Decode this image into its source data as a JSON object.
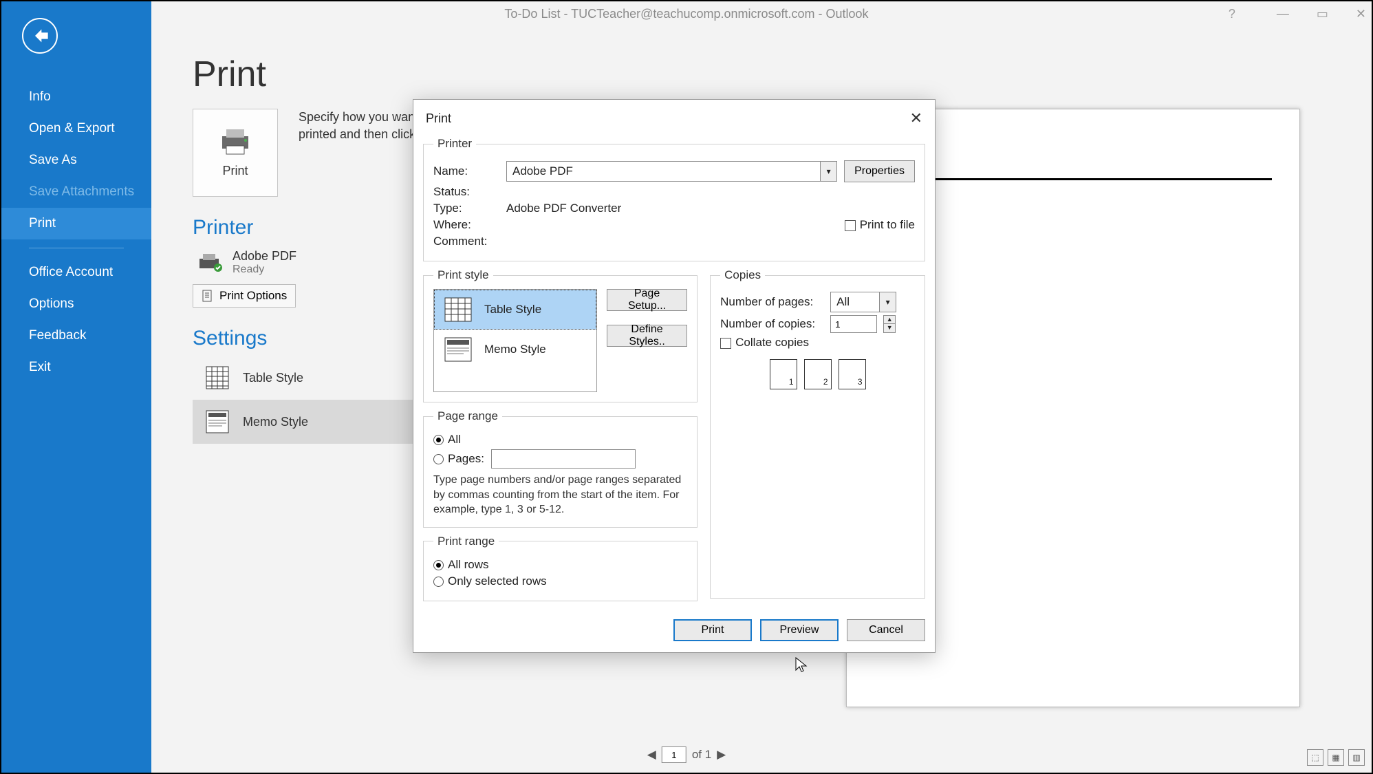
{
  "window": {
    "title": "To-Do List - TUCTeacher@teachucomp.onmicrosoft.com - Outlook"
  },
  "sidebar": {
    "items": [
      {
        "label": "Info"
      },
      {
        "label": "Open & Export"
      },
      {
        "label": "Save As"
      },
      {
        "label": "Save Attachments"
      },
      {
        "label": "Print"
      },
      {
        "label": "Office Account"
      },
      {
        "label": "Options"
      },
      {
        "label": "Feedback"
      },
      {
        "label": "Exit"
      }
    ]
  },
  "page": {
    "title": "Print",
    "print_button": "Print",
    "description": "Specify how you want the item to be printed and then click Print."
  },
  "printer_section": {
    "heading": "Printer",
    "name": "Adobe PDF",
    "status": "Ready",
    "options_button": "Print Options"
  },
  "settings_section": {
    "heading": "Settings",
    "items": [
      {
        "label": "Table Style"
      },
      {
        "label": "Memo Style"
      }
    ]
  },
  "dialog": {
    "title": "Print",
    "printer": {
      "legend": "Printer",
      "name_label": "Name:",
      "name_value": "Adobe PDF",
      "status_label": "Status:",
      "status_value": "",
      "type_label": "Type:",
      "type_value": "Adobe PDF Converter",
      "where_label": "Where:",
      "where_value": "",
      "comment_label": "Comment:",
      "comment_value": "",
      "properties_button": "Properties",
      "print_to_file": "Print to file"
    },
    "print_style": {
      "legend": "Print style",
      "styles": [
        {
          "label": "Table Style"
        },
        {
          "label": "Memo Style"
        }
      ],
      "page_setup_button": "Page Setup...",
      "define_styles_button": "Define Styles.."
    },
    "copies": {
      "legend": "Copies",
      "pages_label": "Number of pages:",
      "pages_value": "All",
      "copies_label": "Number of copies:",
      "copies_value": "1",
      "collate_label": "Collate copies"
    },
    "page_range": {
      "legend": "Page range",
      "all_label": "All",
      "pages_label": "Pages:",
      "pages_value": "",
      "hint": "Type page numbers and/or page ranges separated by commas counting from the start of the item.  For example, type 1, 3 or 5-12."
    },
    "print_range": {
      "legend": "Print range",
      "all_rows": "All rows",
      "selected_rows": "Only selected rows"
    },
    "buttons": {
      "print": "Print",
      "preview": "Preview",
      "cancel": "Cancel"
    }
  },
  "page_nav": {
    "current": "1",
    "of_text": "of 1"
  }
}
